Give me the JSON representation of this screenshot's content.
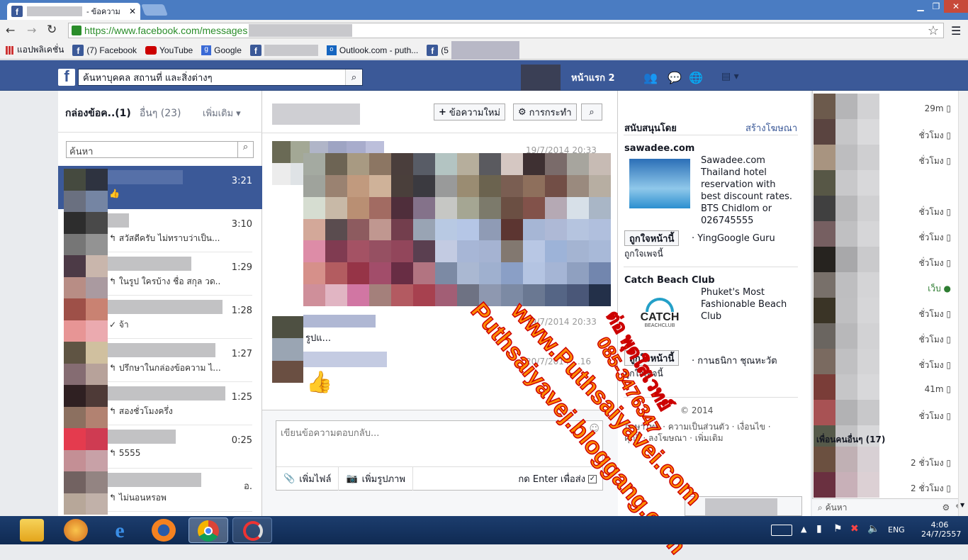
{
  "browser": {
    "tab_title": "- ข้อความ",
    "url": "https://www.facebook.com/messages",
    "bookmarks": [
      "แอปพลิเคชั่น",
      "(7) Facebook",
      "YouTube",
      "Google",
      "Outlook.com - puth...",
      "(5"
    ]
  },
  "fb": {
    "search_placeholder": "ค้นหาบุคคล สถานที่ และสิ่งต่างๆ",
    "home_label": "หน้าแรก",
    "home_count": "2"
  },
  "inbox": {
    "tab_inbox": "กล่องข้อค..",
    "inbox_count": "(1)",
    "tab_other": "อื่นๆ",
    "other_count": "(23)",
    "more": "เพิ่มเติม",
    "search_placeholder": "ค้นหา",
    "threads": [
      {
        "time": "3:21",
        "snippet": ""
      },
      {
        "time": "3:10",
        "snippet": "สวัสดีครับ ไม่ทราบว่าเป็น..."
      },
      {
        "time": "1:29",
        "snippet": "ในรูป ใครบ้าง ชื่อ สกุล วด.."
      },
      {
        "time": "1:28",
        "snippet": "จ้า"
      },
      {
        "time": "1:27",
        "snippet": "ปรึกษาในกล่องข้อความ ไ..."
      },
      {
        "time": "1:25",
        "snippet": "สองชั่วโมงครึ่ง"
      },
      {
        "time": "0:25",
        "snippet": "5555"
      },
      {
        "time": "อ.",
        "snippet": "ไม่นอนหรอพ"
      }
    ]
  },
  "conversation": {
    "new_message": "ข้อความใหม่",
    "actions": "การกระทำ",
    "msg1_date": "19/7/2014 20:33",
    "msg2_date": "19/7/2014 20:33",
    "msg2_text": "รูปแ...",
    "msg3_date": "20/7/2014 ...16",
    "reply_placeholder": "เขียนข้อความตอบกลับ...",
    "add_file": "เพิ่มไฟล์",
    "add_photo": "เพิ่มรูปภาพ",
    "enter_to_send": "กด Enter เพื่อส่ง"
  },
  "ads": {
    "sponsored": "สนับสนุนโดย",
    "create_ad": "สร้างโฆษณา",
    "ad1_title": "sawadee.com",
    "ad1_text": "Sawadee.com Thailand hotel reservation with best discount rates. BTS Chidlom or 026745555",
    "ad1_like": "ถูกใจหน้านี้",
    "ad1_social": "· YingGoogle Guru",
    "ad1_social2": "ถูกใจเพจนี้",
    "ad2_title": "Catch Beach Club",
    "ad2_text": "Phuket's Most Fashionable Beach Club",
    "ad2_logo": "CATCH",
    "ad2_logo_sub": "BEACHCLUB",
    "ad2_like": "ถูกใจหน้านี้",
    "ad2_social": "· กานธนิกา ชุณหะวัต",
    "ad2_social2": "ถูกใจเพจนี้",
    "footer1": "© 2014",
    "footer2": "ภาษาไทย · ความเป็นส่วนตัว · เงื่อนไข ·",
    "footer3": "คุกกี้ · ลงโฆษณา · เพิ่มเติม"
  },
  "chat": {
    "times": [
      "29m",
      "ชั่วโมง",
      "ชั่วโมง",
      "ชั่วโมง",
      "ชั่วโมง",
      "ชั่วโมง",
      "เว็บ",
      "ชั่วโมง",
      "ชั่วโมง",
      "ชั่วโมง",
      "41m",
      "ชั่วโมง"
    ],
    "more_friends": "เพื่อนคนอื่นๆ (17)",
    "more_times": [
      "2 ชั่วโมง",
      "2 ชั่วโมง"
    ],
    "search_placeholder": "ค้นหา"
  },
  "watermark": {
    "line1": "ต่อ พุดใสเวทย์",
    "line2": "085-3476347",
    "line3": "www.Puthsaiyavei.com",
    "line4": "Puthsaiyavej.bloggang.com"
  },
  "taskbar": {
    "lang": "ENG",
    "time": "4:06",
    "date": "24/7/2557"
  }
}
